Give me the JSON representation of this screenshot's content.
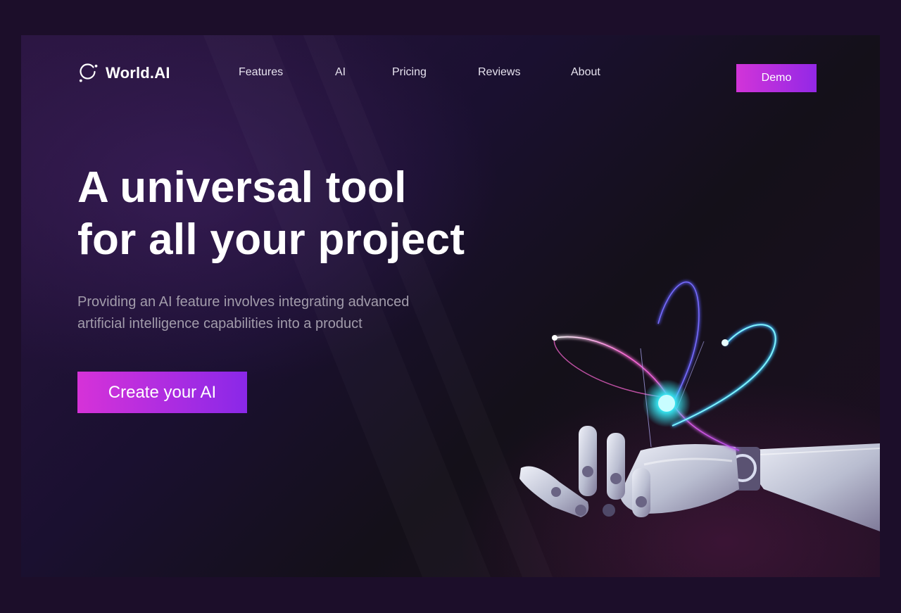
{
  "brand": {
    "name": "World.AI",
    "icon": "orbit-ring-icon"
  },
  "nav": {
    "items": [
      {
        "label": "Features"
      },
      {
        "label": "AI"
      },
      {
        "label": "Pricing"
      },
      {
        "label": "Reviews"
      },
      {
        "label": "About"
      }
    ],
    "demo_label": "Demo"
  },
  "hero": {
    "title_line1": "A universal tool",
    "title_line2": "for all your project",
    "subtitle_line1": "Providing an AI feature involves integrating advanced",
    "subtitle_line2": "artificial intelligence capabilities into a product",
    "cta_label": "Create your AI",
    "illustration": "robot-hand-holding-atom"
  },
  "colors": {
    "page_bg": "#1c0e2a",
    "accent_start": "#d234d8",
    "accent_end": "#9328e6",
    "text_primary": "#ffffff",
    "text_muted": "#a29cab",
    "glow_cyan": "#37e6f2"
  }
}
